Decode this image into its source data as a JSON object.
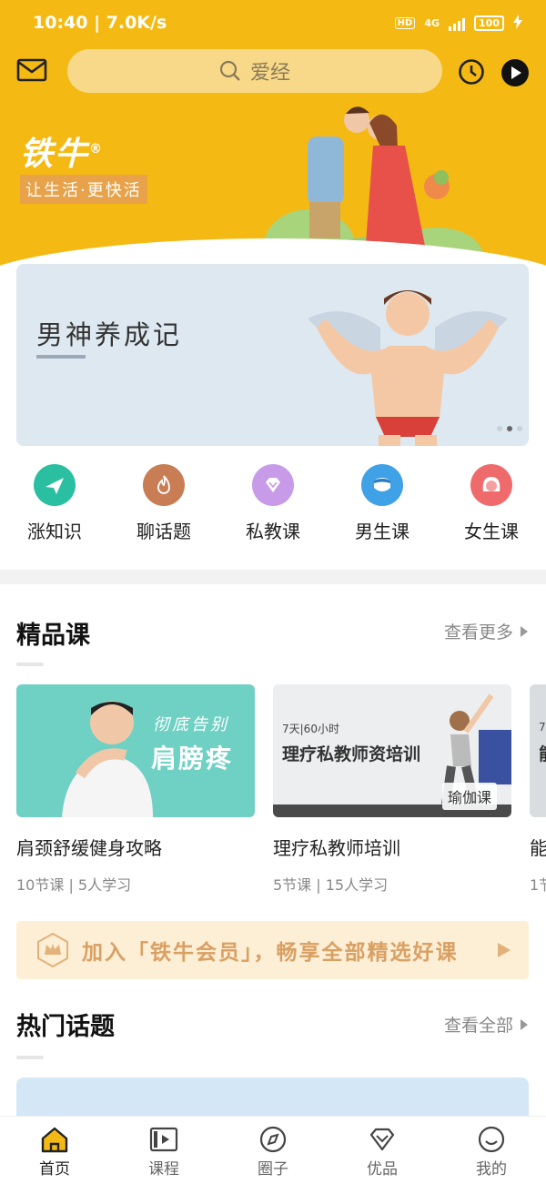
{
  "status_bar": {
    "time": "10:40 | 7.0K/s",
    "hd": "HD",
    "signal": "4G",
    "battery": "100"
  },
  "search": {
    "placeholder": "爱经"
  },
  "hero": {
    "brand": "铁牛",
    "brand_mark": "®",
    "slogan": "让生活·更快活"
  },
  "banner": {
    "title": "男神养成记",
    "active_dot": 2
  },
  "categories": [
    {
      "label": "涨知识",
      "icon": "plane-icon",
      "color": "#2bbfa1"
    },
    {
      "label": "聊话题",
      "icon": "hot-icon",
      "color": "#c97d55"
    },
    {
      "label": "私教课",
      "icon": "diamond-icon",
      "color": "#c79be8"
    },
    {
      "label": "男生课",
      "icon": "male-face-icon",
      "color": "#3fa1e6"
    },
    {
      "label": "女生课",
      "icon": "female-face-icon",
      "color": "#ef6b6b"
    }
  ],
  "premium": {
    "title": "精品课",
    "more": "查看更多",
    "courses": [
      {
        "title": "肩颈舒缓健身攻略",
        "meta": "10节课 | 5人学习",
        "thumb_line1": "彻底告别",
        "thumb_line2": "肩膀疼"
      },
      {
        "title": "理疗私教师培训",
        "meta": "5节课 | 15人学习",
        "thumb_small": "7天|60小时",
        "thumb_main": "理疗私教师资培训",
        "thumb_tag": "瑜伽课"
      },
      {
        "title": "能",
        "meta": "1节",
        "thumb_small": "7",
        "thumb_main": "能"
      }
    ]
  },
  "member": {
    "text": "加入「铁牛会员」，畅享全部精选好课"
  },
  "topics": {
    "title": "热门话题",
    "more": "查看全部"
  },
  "tabs": [
    {
      "label": "首页",
      "icon": "home-icon",
      "active": true
    },
    {
      "label": "课程",
      "icon": "video-icon",
      "active": false
    },
    {
      "label": "圈子",
      "icon": "compass-icon",
      "active": false
    },
    {
      "label": "优品",
      "icon": "diamond-icon",
      "active": false
    },
    {
      "label": "我的",
      "icon": "smile-icon",
      "active": false
    }
  ],
  "colors": {
    "brand_yellow": "#f5b914",
    "member_text": "#d9a063",
    "tab_active": "#f5b914"
  }
}
